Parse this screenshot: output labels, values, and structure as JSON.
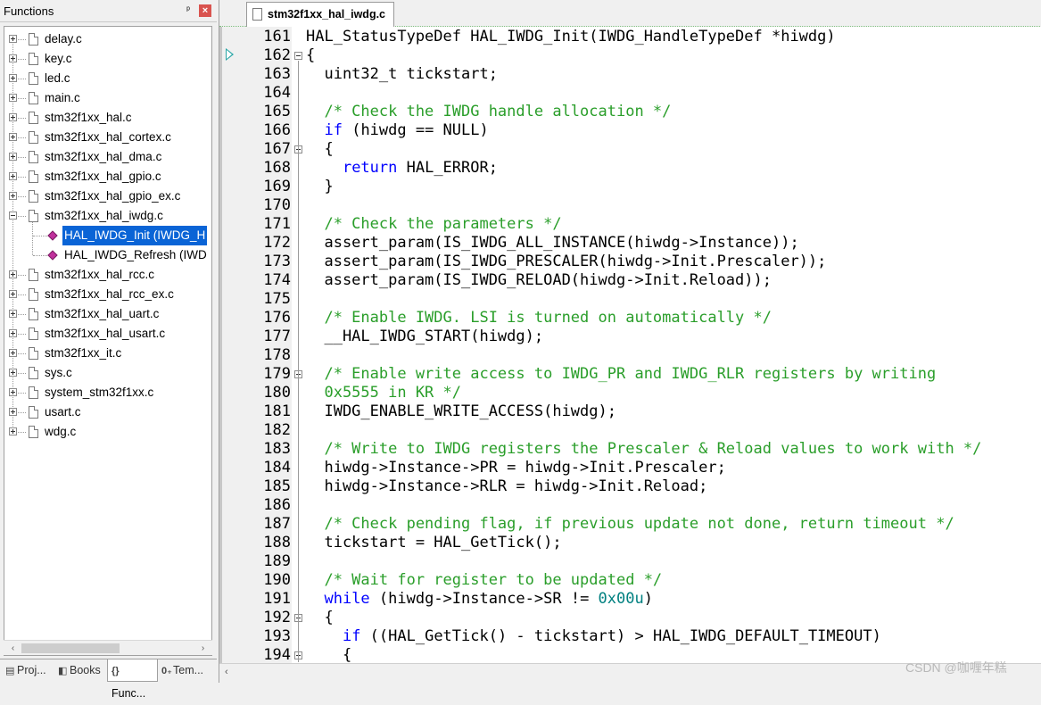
{
  "left_panel": {
    "title": "Functions",
    "pin_glyph": "ᵖ",
    "close_glyph": "×",
    "tree": [
      {
        "label": "delay.c",
        "kind": "file",
        "state": "collapsed"
      },
      {
        "label": "key.c",
        "kind": "file",
        "state": "collapsed"
      },
      {
        "label": "led.c",
        "kind": "file",
        "state": "collapsed"
      },
      {
        "label": "main.c",
        "kind": "file",
        "state": "collapsed"
      },
      {
        "label": "stm32f1xx_hal.c",
        "kind": "file",
        "state": "collapsed"
      },
      {
        "label": "stm32f1xx_hal_cortex.c",
        "kind": "file",
        "state": "collapsed"
      },
      {
        "label": "stm32f1xx_hal_dma.c",
        "kind": "file",
        "state": "collapsed"
      },
      {
        "label": "stm32f1xx_hal_gpio.c",
        "kind": "file",
        "state": "collapsed"
      },
      {
        "label": "stm32f1xx_hal_gpio_ex.c",
        "kind": "file",
        "state": "collapsed"
      },
      {
        "label": "stm32f1xx_hal_iwdg.c",
        "kind": "file",
        "state": "expanded"
      },
      {
        "label": "HAL_IWDG_Init (IWDG_H",
        "kind": "function",
        "selected": true
      },
      {
        "label": "HAL_IWDG_Refresh (IWD",
        "kind": "function"
      },
      {
        "label": "stm32f1xx_hal_rcc.c",
        "kind": "file",
        "state": "collapsed"
      },
      {
        "label": "stm32f1xx_hal_rcc_ex.c",
        "kind": "file",
        "state": "collapsed"
      },
      {
        "label": "stm32f1xx_hal_uart.c",
        "kind": "file",
        "state": "collapsed"
      },
      {
        "label": "stm32f1xx_hal_usart.c",
        "kind": "file",
        "state": "collapsed"
      },
      {
        "label": "stm32f1xx_it.c",
        "kind": "file",
        "state": "collapsed"
      },
      {
        "label": "sys.c",
        "kind": "file",
        "state": "collapsed"
      },
      {
        "label": "system_stm32f1xx.c",
        "kind": "file",
        "state": "collapsed"
      },
      {
        "label": "usart.c",
        "kind": "file",
        "state": "collapsed"
      },
      {
        "label": "wdg.c",
        "kind": "file",
        "state": "collapsed"
      }
    ],
    "scroll_left": "‹",
    "scroll_right": "›",
    "bottom_tabs": [
      {
        "icon": "▤",
        "label": "Proj..."
      },
      {
        "icon": "◧",
        "label": "Books"
      },
      {
        "icon": "{}",
        "label": "Func...",
        "active": true
      },
      {
        "icon": "0₊",
        "label": "Tem..."
      }
    ]
  },
  "editor": {
    "tab_title": "stm32f1xx_hal_iwdg.c",
    "scroll_left": "‹",
    "lines": [
      {
        "n": "161",
        "fold": "",
        "segs": [
          {
            "t": "HAL_StatusTypeDef HAL_IWDG_Init(IWDG_HandleTypeDef *hiwdg)",
            "c": "tx"
          }
        ]
      },
      {
        "n": "162",
        "fold": "open",
        "segs": [
          {
            "t": "{",
            "c": "tx"
          }
        ]
      },
      {
        "n": "163",
        "fold": "",
        "segs": [
          {
            "t": "  uint32_t tickstart;",
            "c": "tx"
          }
        ]
      },
      {
        "n": "164",
        "fold": "",
        "segs": []
      },
      {
        "n": "165",
        "fold": "",
        "segs": [
          {
            "t": "  /* Check the IWDG handle allocation */",
            "c": "cm"
          }
        ]
      },
      {
        "n": "166",
        "fold": "",
        "segs": [
          {
            "t": "  ",
            "c": "tx"
          },
          {
            "t": "if",
            "c": "kw"
          },
          {
            "t": " (hiwdg == NULL)",
            "c": "tx"
          }
        ]
      },
      {
        "n": "167",
        "fold": "open",
        "segs": [
          {
            "t": "  {",
            "c": "tx"
          }
        ]
      },
      {
        "n": "168",
        "fold": "",
        "segs": [
          {
            "t": "    ",
            "c": "tx"
          },
          {
            "t": "return",
            "c": "kw"
          },
          {
            "t": " HAL_ERROR;",
            "c": "tx"
          }
        ]
      },
      {
        "n": "169",
        "fold": "",
        "segs": [
          {
            "t": "  }",
            "c": "tx"
          }
        ]
      },
      {
        "n": "170",
        "fold": "",
        "segs": []
      },
      {
        "n": "171",
        "fold": "",
        "segs": [
          {
            "t": "  /* Check the parameters */",
            "c": "cm"
          }
        ]
      },
      {
        "n": "172",
        "fold": "",
        "segs": [
          {
            "t": "  assert_param(IS_IWDG_ALL_INSTANCE(hiwdg->Instance));",
            "c": "tx"
          }
        ]
      },
      {
        "n": "173",
        "fold": "",
        "segs": [
          {
            "t": "  assert_param(IS_IWDG_PRESCALER(hiwdg->Init.Prescaler));",
            "c": "tx"
          }
        ]
      },
      {
        "n": "174",
        "fold": "",
        "segs": [
          {
            "t": "  assert_param(IS_IWDG_RELOAD(hiwdg->Init.Reload));",
            "c": "tx"
          }
        ]
      },
      {
        "n": "175",
        "fold": "",
        "segs": []
      },
      {
        "n": "176",
        "fold": "",
        "segs": [
          {
            "t": "  /* Enable IWDG. LSI is turned on automatically */",
            "c": "cm"
          }
        ]
      },
      {
        "n": "177",
        "fold": "",
        "segs": [
          {
            "t": "  __HAL_IWDG_START(hiwdg);",
            "c": "tx"
          }
        ]
      },
      {
        "n": "178",
        "fold": "",
        "segs": []
      },
      {
        "n": "179",
        "fold": "open",
        "segs": [
          {
            "t": "  /* Enable write access to IWDG_PR and IWDG_RLR registers by writing",
            "c": "cm"
          }
        ]
      },
      {
        "n": "180",
        "fold": "",
        "segs": [
          {
            "t": "  0x5555 in KR */",
            "c": "cm"
          }
        ]
      },
      {
        "n": "181",
        "fold": "",
        "segs": [
          {
            "t": "  IWDG_ENABLE_WRITE_ACCESS(hiwdg);",
            "c": "tx"
          }
        ]
      },
      {
        "n": "182",
        "fold": "",
        "segs": []
      },
      {
        "n": "183",
        "fold": "",
        "segs": [
          {
            "t": "  /* Write to IWDG registers the Prescaler & Reload values to work with */",
            "c": "cm"
          }
        ]
      },
      {
        "n": "184",
        "fold": "",
        "segs": [
          {
            "t": "  hiwdg->Instance->PR = hiwdg->Init.Prescaler;",
            "c": "tx"
          }
        ]
      },
      {
        "n": "185",
        "fold": "",
        "segs": [
          {
            "t": "  hiwdg->Instance->RLR = hiwdg->Init.Reload;",
            "c": "tx"
          }
        ]
      },
      {
        "n": "186",
        "fold": "",
        "segs": []
      },
      {
        "n": "187",
        "fold": "",
        "segs": [
          {
            "t": "  /* Check pending flag, if previous update not done, return timeout */",
            "c": "cm"
          }
        ]
      },
      {
        "n": "188",
        "fold": "",
        "segs": [
          {
            "t": "  tickstart = HAL_GetTick();",
            "c": "tx"
          }
        ]
      },
      {
        "n": "189",
        "fold": "",
        "segs": []
      },
      {
        "n": "190",
        "fold": "",
        "segs": [
          {
            "t": "  /* Wait for register to be updated */",
            "c": "cm"
          }
        ]
      },
      {
        "n": "191",
        "fold": "",
        "segs": [
          {
            "t": "  ",
            "c": "tx"
          },
          {
            "t": "while",
            "c": "kw"
          },
          {
            "t": " (hiwdg->Instance->SR != ",
            "c": "tx"
          },
          {
            "t": "0x00u",
            "c": "nm"
          },
          {
            "t": ")",
            "c": "tx"
          }
        ]
      },
      {
        "n": "192",
        "fold": "open",
        "segs": [
          {
            "t": "  {",
            "c": "tx"
          }
        ]
      },
      {
        "n": "193",
        "fold": "",
        "segs": [
          {
            "t": "    ",
            "c": "tx"
          },
          {
            "t": "if",
            "c": "kw"
          },
          {
            "t": " ((HAL_GetTick() - tickstart) > HAL_IWDG_DEFAULT_TIMEOUT)",
            "c": "tx"
          }
        ]
      },
      {
        "n": "194",
        "fold": "open",
        "segs": [
          {
            "t": "    {",
            "c": "tx"
          }
        ]
      }
    ]
  },
  "watermark": "CSDN @咖喱年糕"
}
